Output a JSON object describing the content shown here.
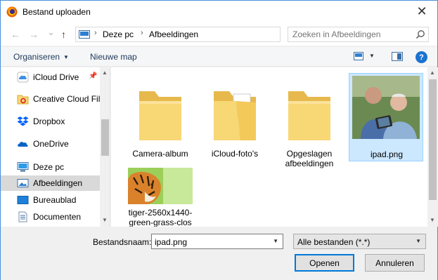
{
  "window": {
    "title": "Bestand uploaden",
    "close_glyph": "✕"
  },
  "nav": {
    "back_glyph": "←",
    "forward_glyph": "→",
    "recent_glyph": "⌄",
    "up_glyph": "↑",
    "breadcrumb": [
      "Deze pc",
      "Afbeeldingen"
    ],
    "breadcrumb_sep": "›",
    "refresh_glyph": "↻"
  },
  "search": {
    "placeholder": "Zoeken in Afbeeldingen"
  },
  "toolbar": {
    "organize_label": "Organiseren",
    "new_folder_label": "Nieuwe map",
    "help_glyph": "?"
  },
  "sidebar": {
    "items": [
      {
        "label": "iCloud Drive",
        "icon": "icloud-icon",
        "pinned": true
      },
      {
        "label": "Creative Cloud Fil",
        "icon": "creative-cloud-folder-icon"
      },
      {
        "label": "Dropbox",
        "icon": "dropbox-icon"
      },
      {
        "label": "OneDrive",
        "icon": "onedrive-icon"
      },
      {
        "label": "Deze pc",
        "icon": "computer-icon"
      },
      {
        "label": "Afbeeldingen",
        "icon": "pictures-icon",
        "selected": true
      },
      {
        "label": "Bureaublad",
        "icon": "desktop-icon"
      },
      {
        "label": "Documenten",
        "icon": "documents-icon"
      }
    ]
  },
  "files": [
    {
      "name": "Camera-album",
      "kind": "folder"
    },
    {
      "name": "iCloud-foto's",
      "kind": "folder-with-files"
    },
    {
      "name": "Opgeslagen afbeeldingen",
      "kind": "folder"
    },
    {
      "name": "ipad.png",
      "kind": "image",
      "selected": true
    },
    {
      "name": "tiger-2560x1440-green-grass-clos",
      "kind": "image"
    }
  ],
  "footer": {
    "filename_label": "Bestandsnaam:",
    "filename_value": "ipad.png",
    "filter_value": "Alle bestanden (*.*)",
    "open_label": "Openen",
    "cancel_label": "Annuleren"
  },
  "colors": {
    "accent": "#0078d7",
    "selection": "#cce8ff",
    "folder": "#f8d775"
  }
}
